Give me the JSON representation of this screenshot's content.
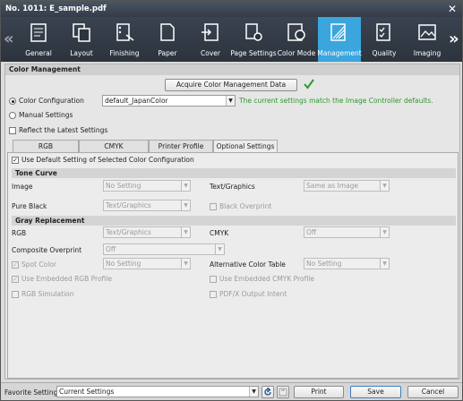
{
  "window": {
    "title": "No. 1011: E_sample.pdf",
    "close_icon": "close-icon"
  },
  "tabs": [
    {
      "label": "General",
      "icon": "general-icon"
    },
    {
      "label": "Layout",
      "icon": "layout-icon"
    },
    {
      "label": "Finishing",
      "icon": "finishing-icon"
    },
    {
      "label": "Paper",
      "icon": "paper-icon"
    },
    {
      "label": "Cover",
      "icon": "cover-icon"
    },
    {
      "label": "Page Settings",
      "icon": "page-settings-icon"
    },
    {
      "label": "Color Mode",
      "icon": "color-mode-icon"
    },
    {
      "label": "Management",
      "icon": "management-icon"
    },
    {
      "label": "Quality",
      "icon": "quality-icon"
    },
    {
      "label": "Imaging",
      "icon": "imaging-icon"
    }
  ],
  "active_tab": "Management",
  "color_management": {
    "section_title": "Color Management",
    "acquire_button": "Acquire Color Management Data",
    "color_configuration_label": "Color Configuration",
    "color_configuration_value": "default_JapanColor",
    "status_message": "The current settings match the Image Controller defaults.",
    "manual_settings_label": "Manual Settings",
    "reflect_latest_label": "Reflect the Latest Settings"
  },
  "content_tabs": [
    "RGB",
    "CMYK",
    "Printer Profile",
    "Optional Settings"
  ],
  "active_content_tab": "Optional Settings",
  "optional": {
    "use_default_label": "Use Default Setting of Selected Color Configuration",
    "tone_curve_header": "Tone Curve",
    "image_label": "Image",
    "image_value": "No Setting",
    "text_graphics_label": "Text/Graphics",
    "text_graphics_value": "Same as Image",
    "pure_black_label": "Pure Black",
    "pure_black_value": "Text/Graphics",
    "black_overprint_label": "Black Overprint",
    "gray_replacement_header": "Gray Replacement",
    "rgb_label": "RGB",
    "rgb_value": "Text/Graphics",
    "cmyk_label": "CMYK",
    "cmyk_value": "Off",
    "composite_overprint_label": "Composite Overprint",
    "composite_overprint_value": "Off",
    "spot_color_label": "Spot Color",
    "spot_color_value": "No Setting",
    "alt_color_table_label": "Alternative Color Table",
    "alt_color_table_value": "No Setting",
    "use_embedded_rgb_label": "Use Embedded RGB Profile",
    "use_embedded_cmyk_label": "Use Embedded CMYK Profile",
    "rgb_simulation_label": "RGB Simulation",
    "pdfx_output_label": "PDF/X Output Intent"
  },
  "footer": {
    "favorite_label": "Favorite Setting",
    "favorite_value": "Current Settings",
    "print_button": "Print",
    "save_button": "Save",
    "cancel_button": "Cancel"
  },
  "colors": {
    "accent": "#3aa6dd",
    "status_green": "#2c9a2c",
    "titlebar": "#3b4451"
  }
}
